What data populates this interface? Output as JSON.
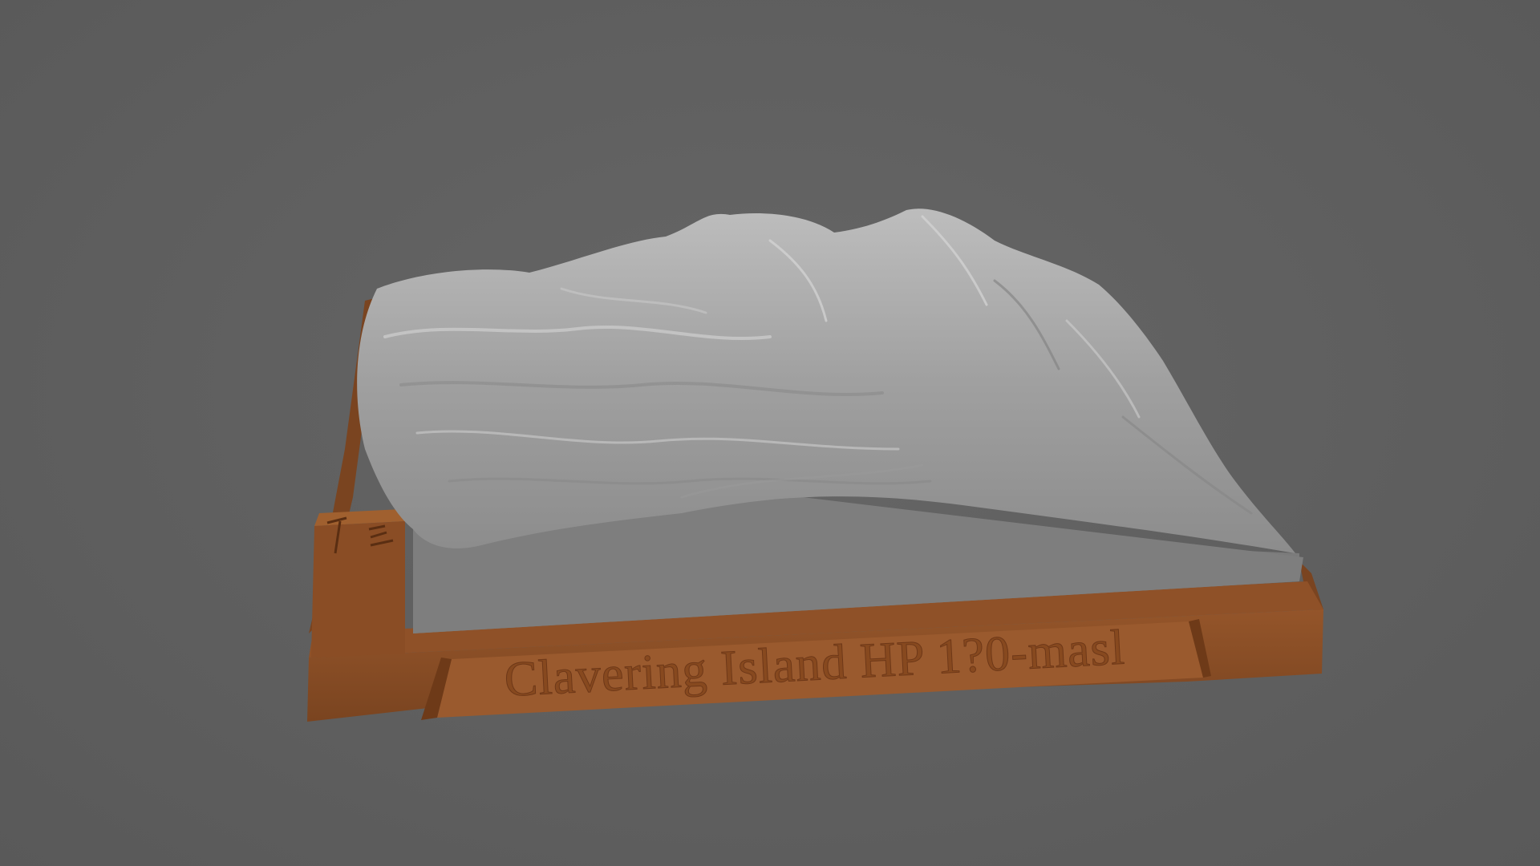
{
  "viewport": {
    "background_color": "#5f5f5f",
    "object": "3D printed terrain relief model on brown base"
  },
  "model": {
    "terrain_color": "#9b9b9b",
    "base_color": "#8b4f26",
    "base_side_color": "#6e3c1c",
    "flat_area_color": "#7c7c7c",
    "label_text": "Clavering Island HP 1?0-masl",
    "label_icon": "hammer-icon"
  }
}
